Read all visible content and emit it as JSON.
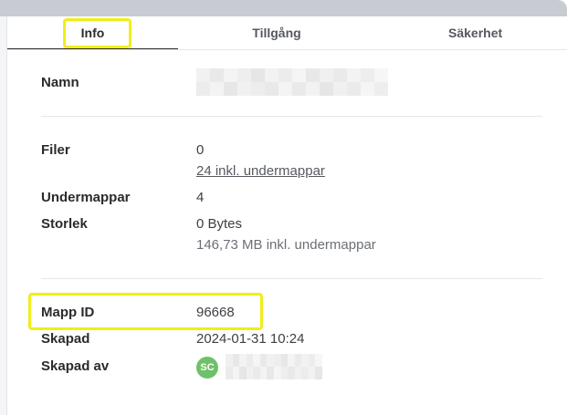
{
  "tabs": [
    {
      "label": "Info",
      "active": true
    },
    {
      "label": "Tillgång",
      "active": false
    },
    {
      "label": "Säkerhet",
      "active": false
    }
  ],
  "details": {
    "name_label": "Namn",
    "files_label": "Filer",
    "files_value": "0",
    "files_incl_link": "24 inkl. undermappar",
    "subfolders_label": "Undermappar",
    "subfolders_value": "4",
    "size_label": "Storlek",
    "size_value": "0 Bytes",
    "size_incl": "146,73 MB inkl. undermappar",
    "folder_id_label": "Mapp ID",
    "folder_id_value": "96668",
    "created_label": "Skapad",
    "created_value": "2024-01-31 10:24",
    "created_by_label": "Skapad av",
    "created_by_initials": "SC"
  },
  "colors": {
    "highlight": "#f0ee18",
    "avatar": "#6fc169"
  }
}
